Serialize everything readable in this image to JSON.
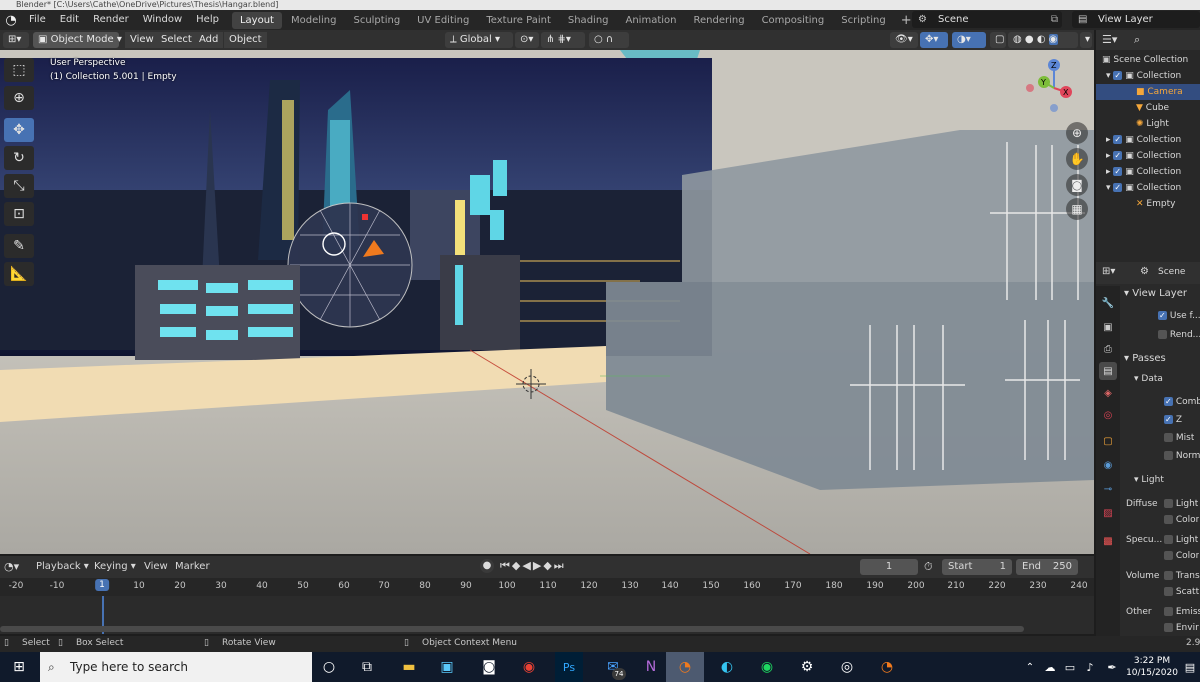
{
  "window": {
    "title": "Blender* [C:\\Users\\Cathe\\OneDrive\\Pictures\\Thesis\\Hangar.blend]"
  },
  "menubar": {
    "menus": [
      "File",
      "Edit",
      "Render",
      "Window",
      "Help"
    ],
    "workspaces": [
      "Layout",
      "Modeling",
      "Sculpting",
      "UV Editing",
      "Texture Paint",
      "Shading",
      "Animation",
      "Rendering",
      "Compositing",
      "Scripting"
    ],
    "active_workspace": "Layout",
    "add_workspace": "+",
    "scene": "Scene",
    "view_layer": "View Layer"
  },
  "viewport_header": {
    "mode": "Object Mode",
    "menus": [
      "View",
      "Select",
      "Add",
      "Object"
    ],
    "orientation": "Global"
  },
  "viewport": {
    "overlay_line1": "User Perspective",
    "overlay_line2": "(1) Collection 5.001 | Empty",
    "gizmo": {
      "x": "X",
      "y": "Y",
      "z": "Z"
    }
  },
  "outliner": {
    "rows": [
      {
        "label": "Scene Collection",
        "indent": 0,
        "check": false,
        "icon": "collection-icon",
        "selected": false
      },
      {
        "label": "Collection",
        "indent": 1,
        "check": true,
        "icon": "collection-icon",
        "selected": false
      },
      {
        "label": "Camera",
        "indent": 2,
        "check": false,
        "icon": "camera-icon",
        "selected": true
      },
      {
        "label": "Cube",
        "indent": 2,
        "check": false,
        "icon": "mesh-icon",
        "selected": false
      },
      {
        "label": "Light",
        "indent": 2,
        "check": false,
        "icon": "light-icon",
        "selected": false
      },
      {
        "label": "Collection",
        "indent": 1,
        "check": true,
        "icon": "collection-icon",
        "selected": false
      },
      {
        "label": "Collection",
        "indent": 1,
        "check": true,
        "icon": "collection-icon",
        "selected": false
      },
      {
        "label": "Collection",
        "indent": 1,
        "check": true,
        "icon": "collection-icon",
        "selected": false
      },
      {
        "label": "Collection",
        "indent": 1,
        "check": true,
        "icon": "collection-icon",
        "selected": false
      },
      {
        "label": "Empty",
        "indent": 2,
        "check": false,
        "icon": "empty-icon",
        "selected": false
      }
    ]
  },
  "properties": {
    "scene_label": "Scene",
    "view_layer_panel": "View Layer",
    "use_for_rendering": "Use f...",
    "render_single": "Rend...",
    "passes_panel": "Passes",
    "data_panel": "Data",
    "data_items": [
      {
        "label": "Comb",
        "checked": true
      },
      {
        "label": "Z",
        "checked": true
      },
      {
        "label": "Mist",
        "checked": false
      },
      {
        "label": "Norm",
        "checked": false
      }
    ],
    "light_panel": "Light",
    "light_rows": [
      {
        "group": "Diffuse",
        "label": "Light"
      },
      {
        "group": "",
        "label": "Color"
      },
      {
        "group": "Specu...",
        "label": "Light"
      },
      {
        "group": "",
        "label": "Color"
      },
      {
        "group": "Volume",
        "label": "Trans"
      },
      {
        "group": "",
        "label": "Scatt"
      },
      {
        "group": "Other",
        "label": "Emiss"
      },
      {
        "group": "",
        "label": "Envir"
      }
    ]
  },
  "timeline": {
    "menus": [
      "Playback",
      "Keying",
      "View",
      "Marker"
    ],
    "current_frame": "1",
    "start_label": "Start",
    "start": "1",
    "end_label": "End",
    "end": "250",
    "ruler": [
      "-20",
      "-10",
      "1",
      "10",
      "20",
      "30",
      "40",
      "50",
      "60",
      "70",
      "80",
      "90",
      "100",
      "110",
      "120",
      "130",
      "140",
      "150",
      "160",
      "170",
      "180",
      "190",
      "200",
      "210",
      "220",
      "230",
      "240"
    ]
  },
  "statusbar": {
    "select": "Select",
    "box_select": "Box Select",
    "rotate_view": "Rotate View",
    "context_menu": "Object Context Menu",
    "version": "2.9"
  },
  "taskbar": {
    "search_placeholder": "Type here to search",
    "mail_badge": "74",
    "time": "3:22 PM",
    "date": "10/15/2020"
  }
}
